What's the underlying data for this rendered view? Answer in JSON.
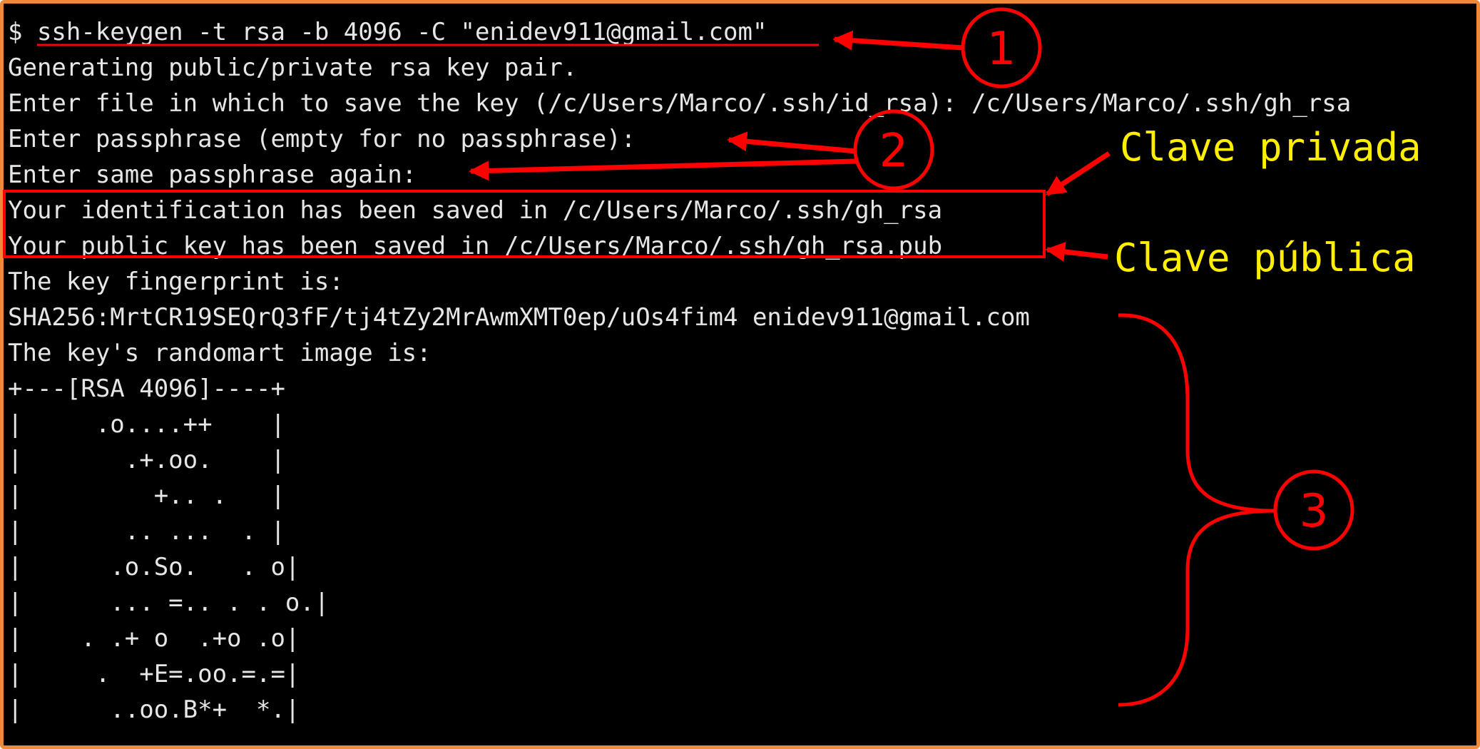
{
  "terminal": {
    "lines": [
      "$ ssh-keygen -t rsa -b 4096 -C \"enidev911@gmail.com\"",
      "Generating public/private rsa key pair.",
      "Enter file in which to save the key (/c/Users/Marco/.ssh/id_rsa): /c/Users/Marco/.ssh/gh_rsa",
      "Enter passphrase (empty for no passphrase):",
      "Enter same passphrase again:",
      "Your identification has been saved in /c/Users/Marco/.ssh/gh_rsa",
      "Your public key has been saved in /c/Users/Marco/.ssh/gh_rsa.pub",
      "The key fingerprint is:",
      "SHA256:MrtCR19SEQrQ3fF/tj4tZy2MrAwmXMT0ep/uOs4fim4 enidev911@gmail.com",
      "The key's randomart image is:",
      "+---[RSA 4096]----+",
      "|     .o....++    |",
      "|       .+.oo.    |",
      "|         +.. .   |",
      "|       .. ...  . |",
      "|      .o.So.   . o|",
      "|      ... =.. . . o.|",
      "|    . .+ o  .+o .o|",
      "|     .  +E=.oo.=.=|",
      "|      ..oo.B*+  *.|"
    ]
  },
  "annotations": {
    "step1": "1",
    "step2": "2",
    "step3": "3",
    "private_key_label": "Clave privada",
    "public_key_label": "Clave pública"
  },
  "colors": {
    "terminal_background": "#000000",
    "terminal_text": "#e6e6e6",
    "frame_border": "#ee8a3a",
    "annotation_red": "#ff0000",
    "label_yellow": "#ffee00"
  }
}
